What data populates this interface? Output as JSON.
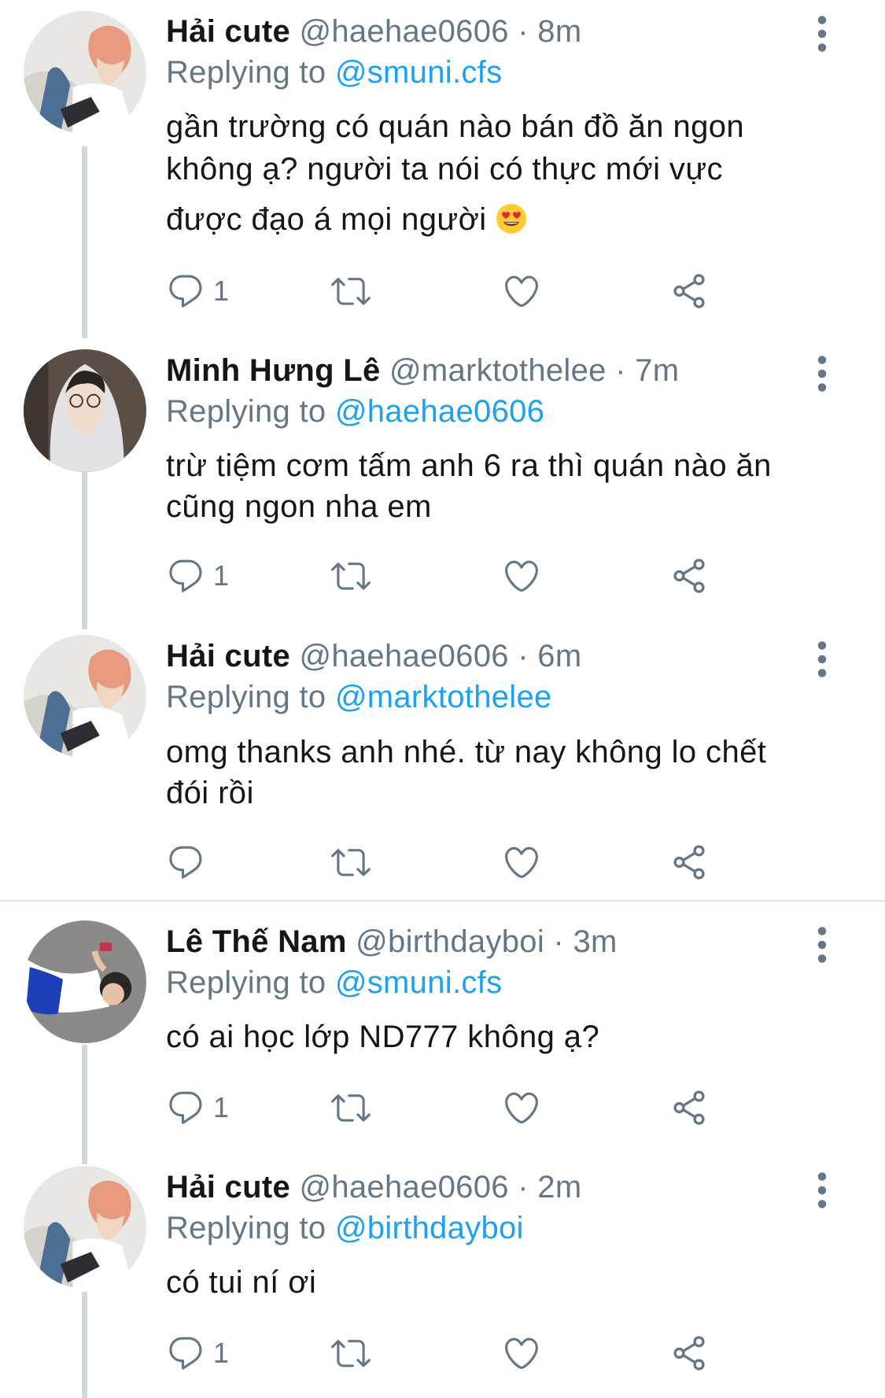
{
  "tweets": [
    {
      "display_name": "Hải cute",
      "handle": "@haehae0606",
      "time": "8m",
      "replying_label": "Replying to",
      "replying_to": "@smuni.cfs",
      "text_lines": [
        "gần trường có quán nào bán đồ ăn ngon",
        "không ạ? người ta nói có thực mới vực",
        "được đạo á mọi người"
      ],
      "emoji": "heart-eyes-emoji",
      "reply_count": "1",
      "avatar": "pink-hair-avatar"
    },
    {
      "display_name": "Minh Hưng Lê",
      "handle": "@marktothelee",
      "time": "7m",
      "replying_label": "Replying to",
      "replying_to": "@haehae0606",
      "text_lines": [
        "trừ tiệm cơm tấm anh 6 ra thì quán nào ăn",
        "cũng ngon nha em"
      ],
      "reply_count": "1",
      "avatar": "hoodie-avatar"
    },
    {
      "display_name": "Hải cute",
      "handle": "@haehae0606",
      "time": "6m",
      "replying_label": "Replying to",
      "replying_to": "@marktothelee",
      "text_lines": [
        "omg thanks anh nhé. từ nay không lo chết",
        "đói rồi"
      ],
      "reply_count": "",
      "avatar": "pink-hair-avatar"
    },
    {
      "display_name": "Lê Thế Nam",
      "handle": "@birthdayboi",
      "time": "3m",
      "replying_label": "Replying to",
      "replying_to": "@smuni.cfs",
      "text_lines": [
        "có ai học lớp ND777 không ạ?"
      ],
      "reply_count": "1",
      "avatar": "lying-person-avatar"
    },
    {
      "display_name": "Hải cute",
      "handle": "@haehae0606",
      "time": "2m",
      "replying_label": "Replying to",
      "replying_to": "@birthdayboi",
      "text_lines": [
        "có tui ní ơi"
      ],
      "reply_count": "1",
      "avatar": "pink-hair-avatar"
    }
  ],
  "separator_dot": "·",
  "icons": {
    "reply": "reply-icon",
    "retweet": "retweet-icon",
    "like": "like-icon",
    "share": "share-icon",
    "more": "more-icon"
  },
  "colors": {
    "text": "#14171a",
    "secondary": "#657786",
    "mention": "#1da1f2",
    "thread_line": "#cfd9de"
  }
}
